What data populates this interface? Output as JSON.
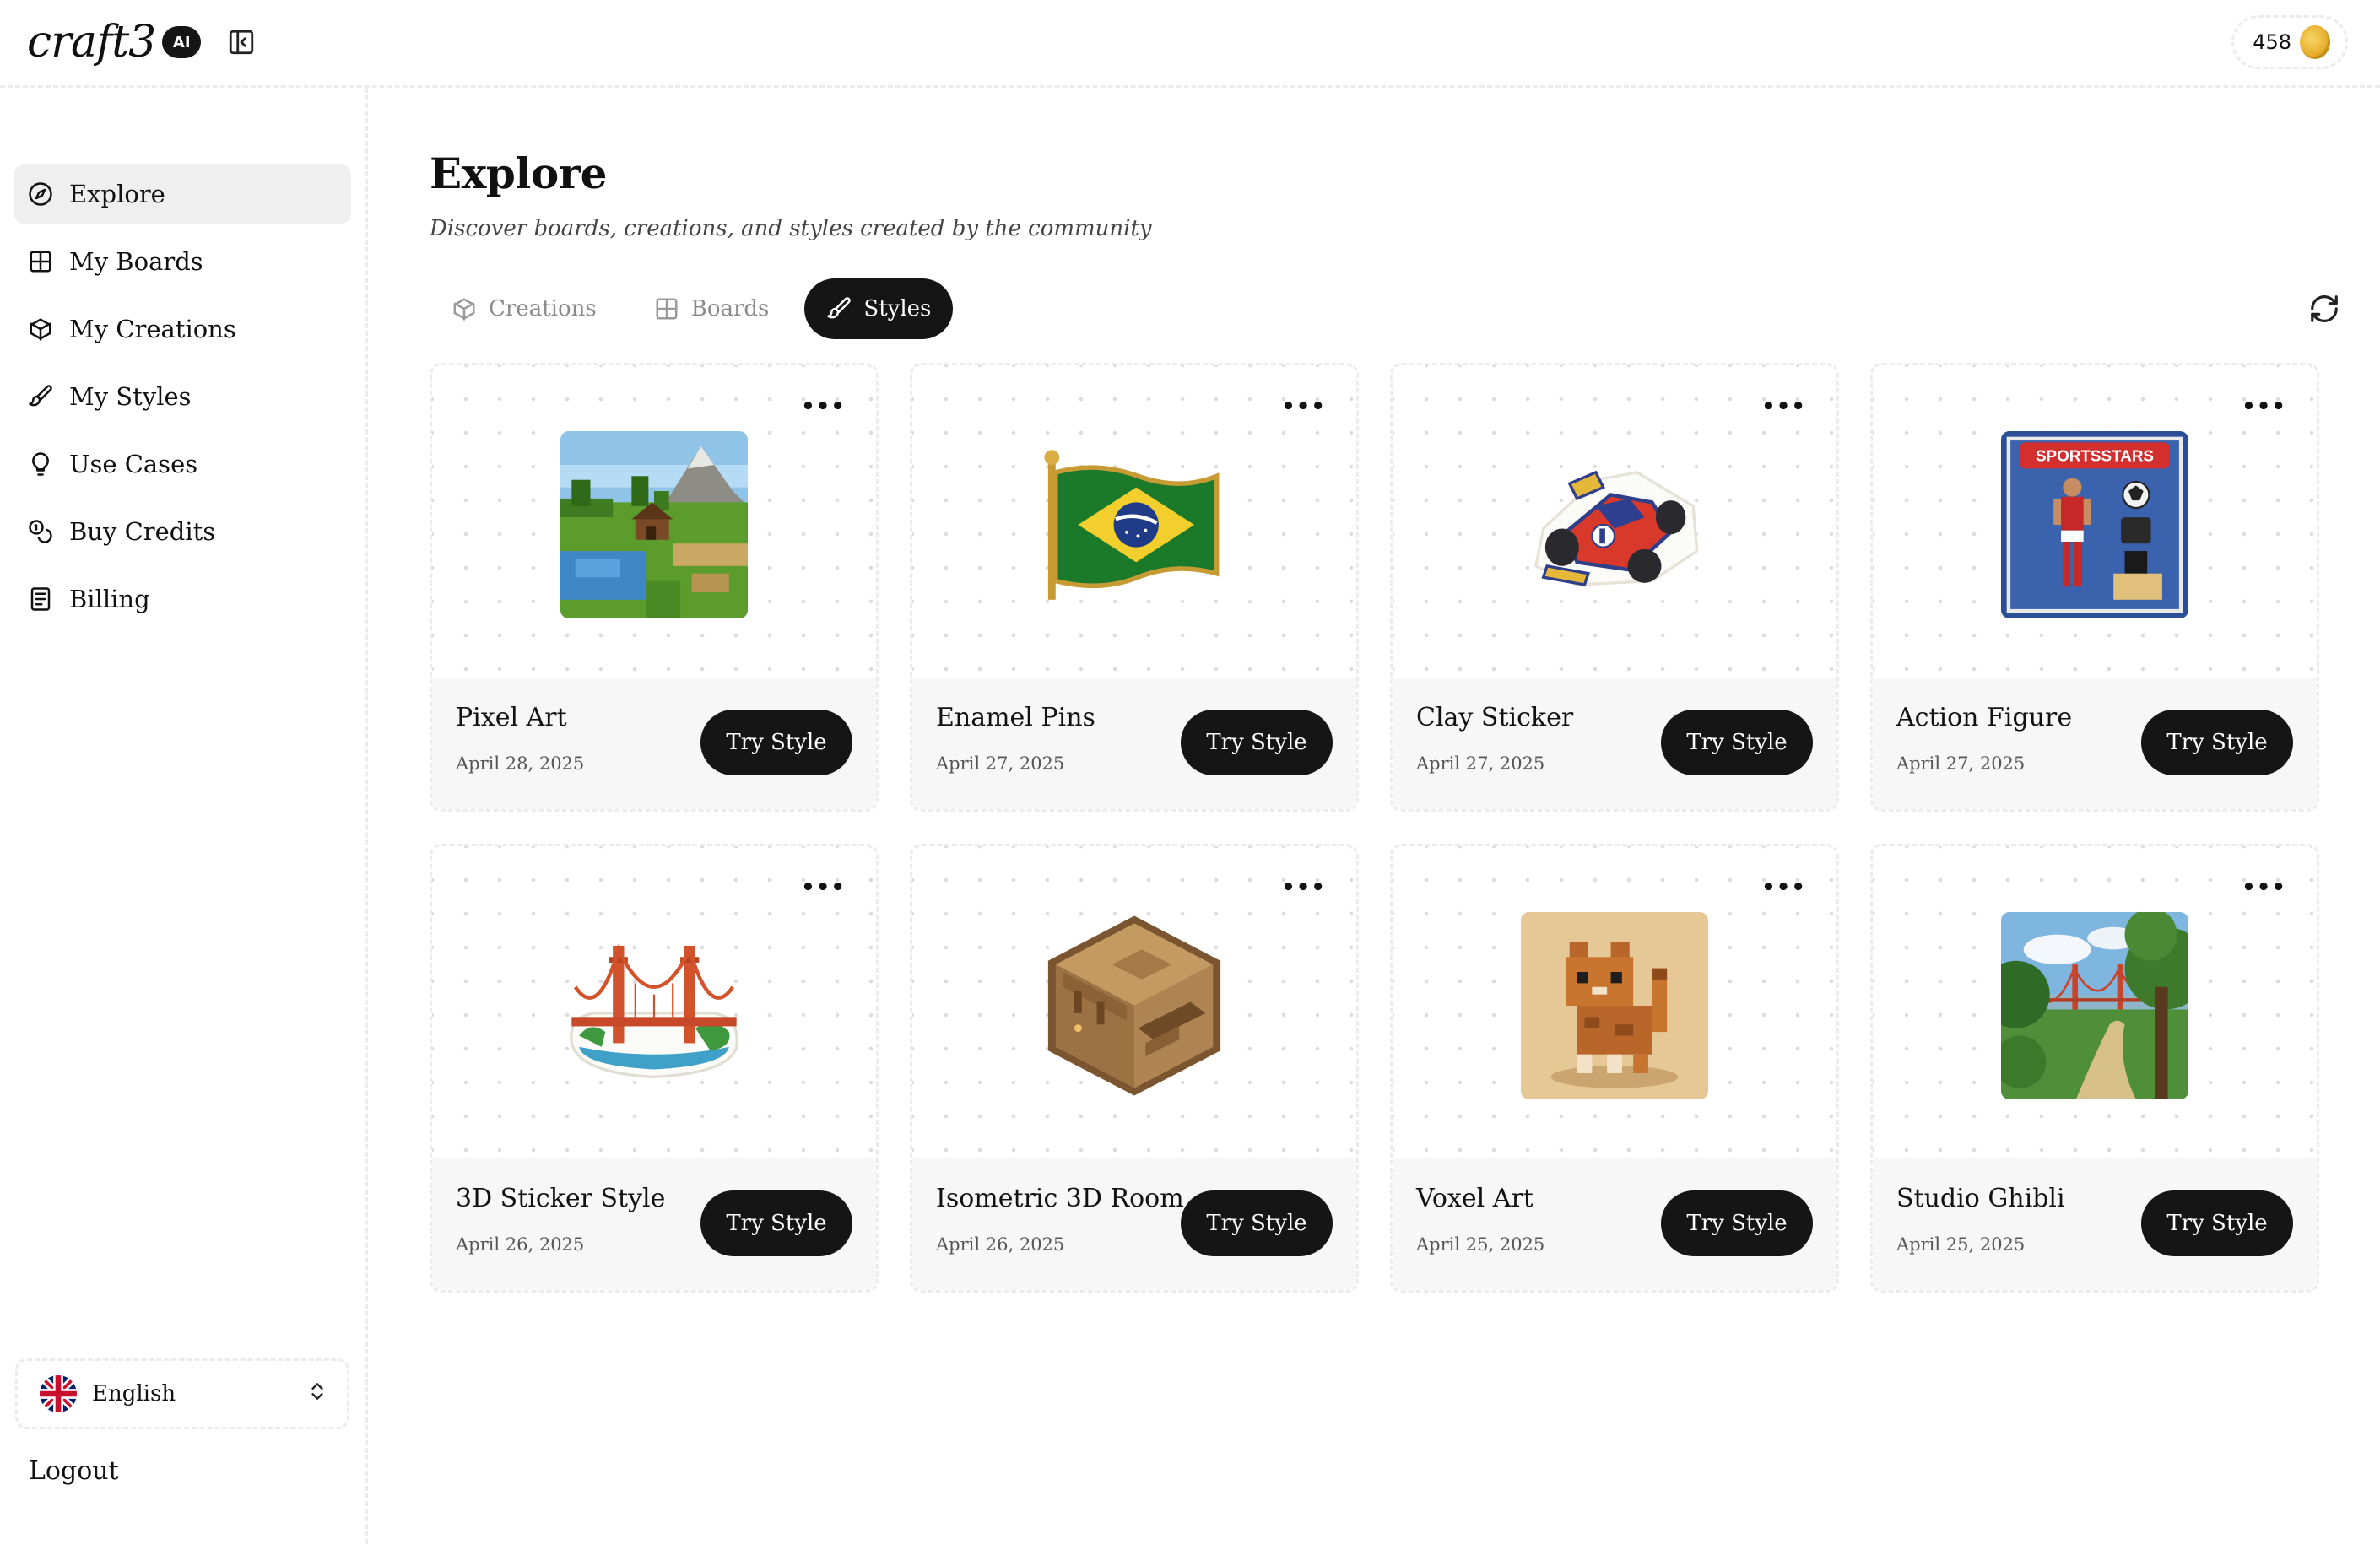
{
  "header": {
    "logo_text": "craft3",
    "ai_badge": "AI",
    "credits": "458"
  },
  "sidebar": {
    "items": [
      {
        "label": "Explore",
        "icon": "compass-icon",
        "active": true
      },
      {
        "label": "My Boards",
        "icon": "grid-icon",
        "active": false
      },
      {
        "label": "My Creations",
        "icon": "cube-icon",
        "active": false
      },
      {
        "label": "My Styles",
        "icon": "brush-icon",
        "active": false
      },
      {
        "label": "Use Cases",
        "icon": "lightbulb-icon",
        "active": false
      },
      {
        "label": "Buy Credits",
        "icon": "coins-icon",
        "active": false
      },
      {
        "label": "Billing",
        "icon": "receipt-icon",
        "active": false
      }
    ],
    "language": "English",
    "logout": "Logout"
  },
  "main": {
    "title": "Explore",
    "subtitle": "Discover boards, creations, and styles created by the community",
    "tabs": [
      {
        "label": "Creations",
        "icon": "cube-icon",
        "active": false
      },
      {
        "label": "Boards",
        "icon": "grid-icon",
        "active": false
      },
      {
        "label": "Styles",
        "icon": "brush-icon",
        "active": true
      }
    ],
    "cards": [
      {
        "name": "Pixel Art",
        "date": "April 28, 2025",
        "button": "Try Style",
        "more": "•••"
      },
      {
        "name": "Enamel Pins",
        "date": "April 27, 2025",
        "button": "Try Style",
        "more": "•••"
      },
      {
        "name": "Clay Sticker",
        "date": "April 27, 2025",
        "button": "Try Style",
        "more": "•••"
      },
      {
        "name": "Action Figure",
        "date": "April 27, 2025",
        "button": "Try Style",
        "more": "•••",
        "thumb_text": "SPORTSSTARS"
      },
      {
        "name": "3D Sticker Style",
        "date": "April 26, 2025",
        "button": "Try Style",
        "more": "•••"
      },
      {
        "name": "Isometric 3D Room",
        "date": "April 26, 2025",
        "button": "Try Style",
        "more": "•••"
      },
      {
        "name": "Voxel Art",
        "date": "April 25, 2025",
        "button": "Try Style",
        "more": "•••"
      },
      {
        "name": "Studio Ghibli",
        "date": "April 25, 2025",
        "button": "Try Style",
        "more": "•••"
      }
    ]
  },
  "colors": {
    "primary_dark": "#151515",
    "active_bg": "#efefef",
    "card_footer": "#f7f7f7",
    "coin": "#e3a51c"
  }
}
